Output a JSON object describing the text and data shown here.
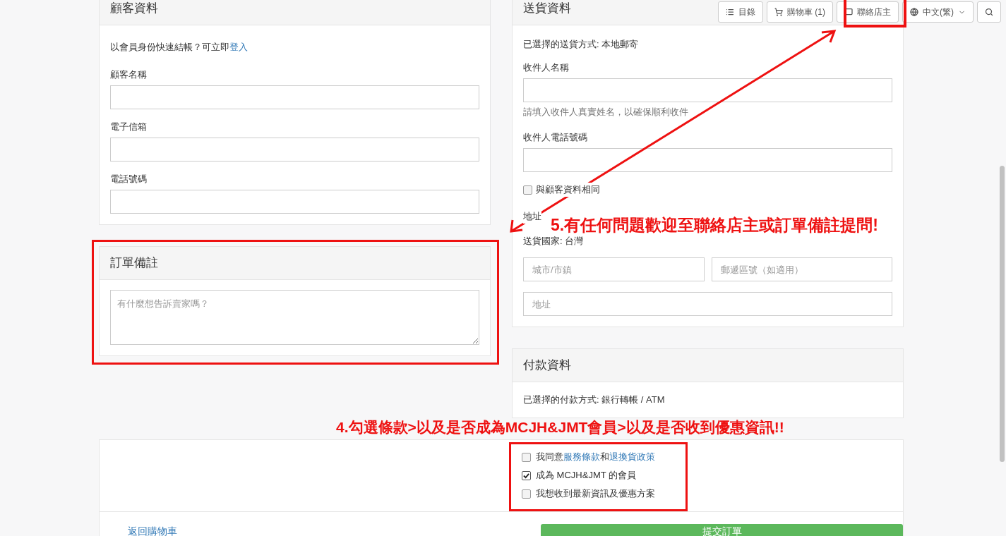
{
  "toolbar": {
    "buttons": [
      {
        "kind": "menu",
        "label": "目錄"
      },
      {
        "kind": "cart",
        "label": "購物車 (1)"
      },
      {
        "kind": "chat",
        "label": "聯絡店主"
      },
      {
        "kind": "language",
        "label": "中文(繁)"
      },
      {
        "kind": "search"
      }
    ]
  },
  "customer": {
    "title": "顧客資料",
    "login_prompt": "以會員身份快速結帳？可立即",
    "login_link": "登入",
    "fields": [
      {
        "label": "顧客名稱"
      },
      {
        "label": "電子信箱"
      },
      {
        "label": "電話號碼"
      }
    ]
  },
  "order_note": {
    "title": "訂單備註",
    "placeholder": "有什麼想告訴賣家嗎？"
  },
  "shipping": {
    "title": "送貨資料",
    "method": "已選擇的送貨方式: 本地郵寄",
    "recipient_label": "收件人名稱",
    "recipient_help": "請填入收件人真實姓名，以確保順利收件",
    "phone_label": "收件人電話號碼",
    "same_as_customer": {
      "label": "與顧客資料相同",
      "checked": false
    },
    "address_label": "地址",
    "country": "送貨國家: 台灣",
    "city_placeholder": "城市/市鎮",
    "zip_placeholder": "郵遞區號（如適用）",
    "address_placeholder": "地址"
  },
  "payment": {
    "title": "付款資料",
    "method": "已選擇的付款方式: 銀行轉帳 / ATM"
  },
  "agreements": [
    {
      "checked": false,
      "parts": [
        {
          "text": "我同意",
          "link": false
        },
        {
          "text": "服務條款",
          "link": true
        },
        {
          "text": "和",
          "link": false
        },
        {
          "text": "退換貨政策",
          "link": true
        }
      ]
    },
    {
      "checked": true,
      "parts": [
        {
          "text": "成為 MCJH&JMT 的會員",
          "link": false
        }
      ]
    },
    {
      "checked": false,
      "parts": [
        {
          "text": "我想收到最新資訊及優惠方案",
          "link": false
        }
      ]
    }
  ],
  "back_link": "返回購物車",
  "submit_button": "提交訂單",
  "annotations": {
    "contact_note": "5.有任何問題歡迎至聯絡店主或訂單備註提問!",
    "checkbox_note": "4.勾選條款>以及是否成為MCJH&JMT會員>以及是否收到優惠資訊!!"
  }
}
